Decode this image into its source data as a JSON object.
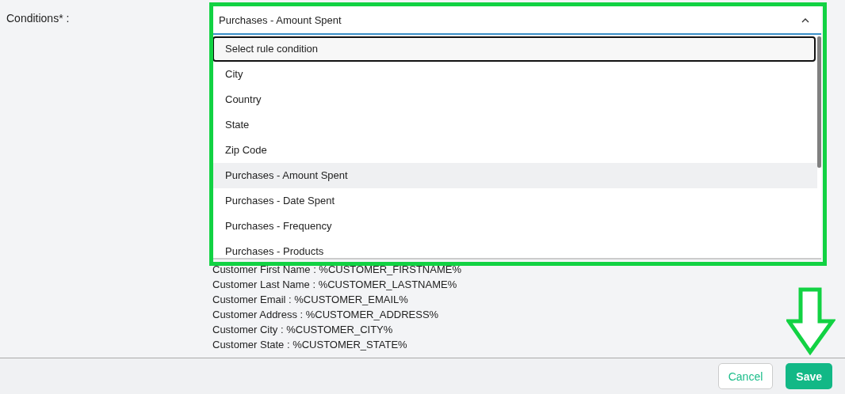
{
  "form": {
    "label": "Conditions* :",
    "select": {
      "value": "Purchases - Amount Spent",
      "expanded": true
    },
    "options": [
      {
        "label": "Select rule condition",
        "focused": true,
        "selected": false
      },
      {
        "label": "City",
        "focused": false,
        "selected": false
      },
      {
        "label": "Country",
        "focused": false,
        "selected": false
      },
      {
        "label": "State",
        "focused": false,
        "selected": false
      },
      {
        "label": "Zip Code",
        "focused": false,
        "selected": false
      },
      {
        "label": "Purchases - Amount Spent",
        "focused": false,
        "selected": true
      },
      {
        "label": "Purchases - Date Spent",
        "focused": false,
        "selected": false
      },
      {
        "label": "Purchases - Frequency",
        "focused": false,
        "selected": false
      },
      {
        "label": "Purchases - Products",
        "focused": false,
        "selected": false
      }
    ],
    "variables": [
      "Customer First Name : %CUSTOMER_FIRSTNAME%",
      "Customer Last Name : %CUSTOMER_LASTNAME%",
      "Customer Email : %CUSTOMER_EMAIL%",
      "Customer Address : %CUSTOMER_ADDRESS%",
      "Customer City : %CUSTOMER_CITY%",
      "Customer State : %CUSTOMER_STATE%"
    ]
  },
  "footer": {
    "buttons": [
      {
        "label": "Cancel",
        "kind": "secondary"
      },
      {
        "label": "Save",
        "kind": "primary"
      }
    ]
  }
}
